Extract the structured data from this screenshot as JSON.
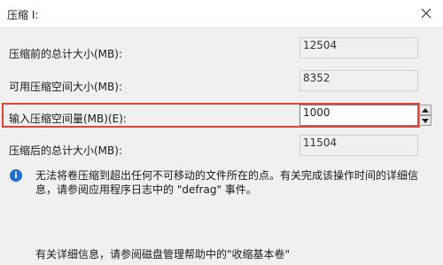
{
  "window": {
    "title": "压缩 I:"
  },
  "rows": {
    "total_before": {
      "label": "压缩前的总计大小(MB):",
      "value": "12504"
    },
    "available": {
      "label": "可用压缩空间大小(MB):",
      "value": "8352"
    },
    "amount": {
      "label": "输入压缩空间量(MB)(E):",
      "value": "1000"
    },
    "total_after": {
      "label": "压缩后的总计大小(MB):",
      "value": "11504"
    }
  },
  "info": {
    "icon": "info-icon",
    "text": "无法将卷压缩到超出任何不可移动的文件所在的点。有关完成该操作时间的详细信息，请参阅应用程序日志中的 \"defrag\" 事件。"
  },
  "help": {
    "text": "有关详细信息，请参阅磁盘管理帮助中的\"收缩基本卷\""
  },
  "colors": {
    "highlight": "#e0453a",
    "info_icon": "#1f6fd1"
  }
}
